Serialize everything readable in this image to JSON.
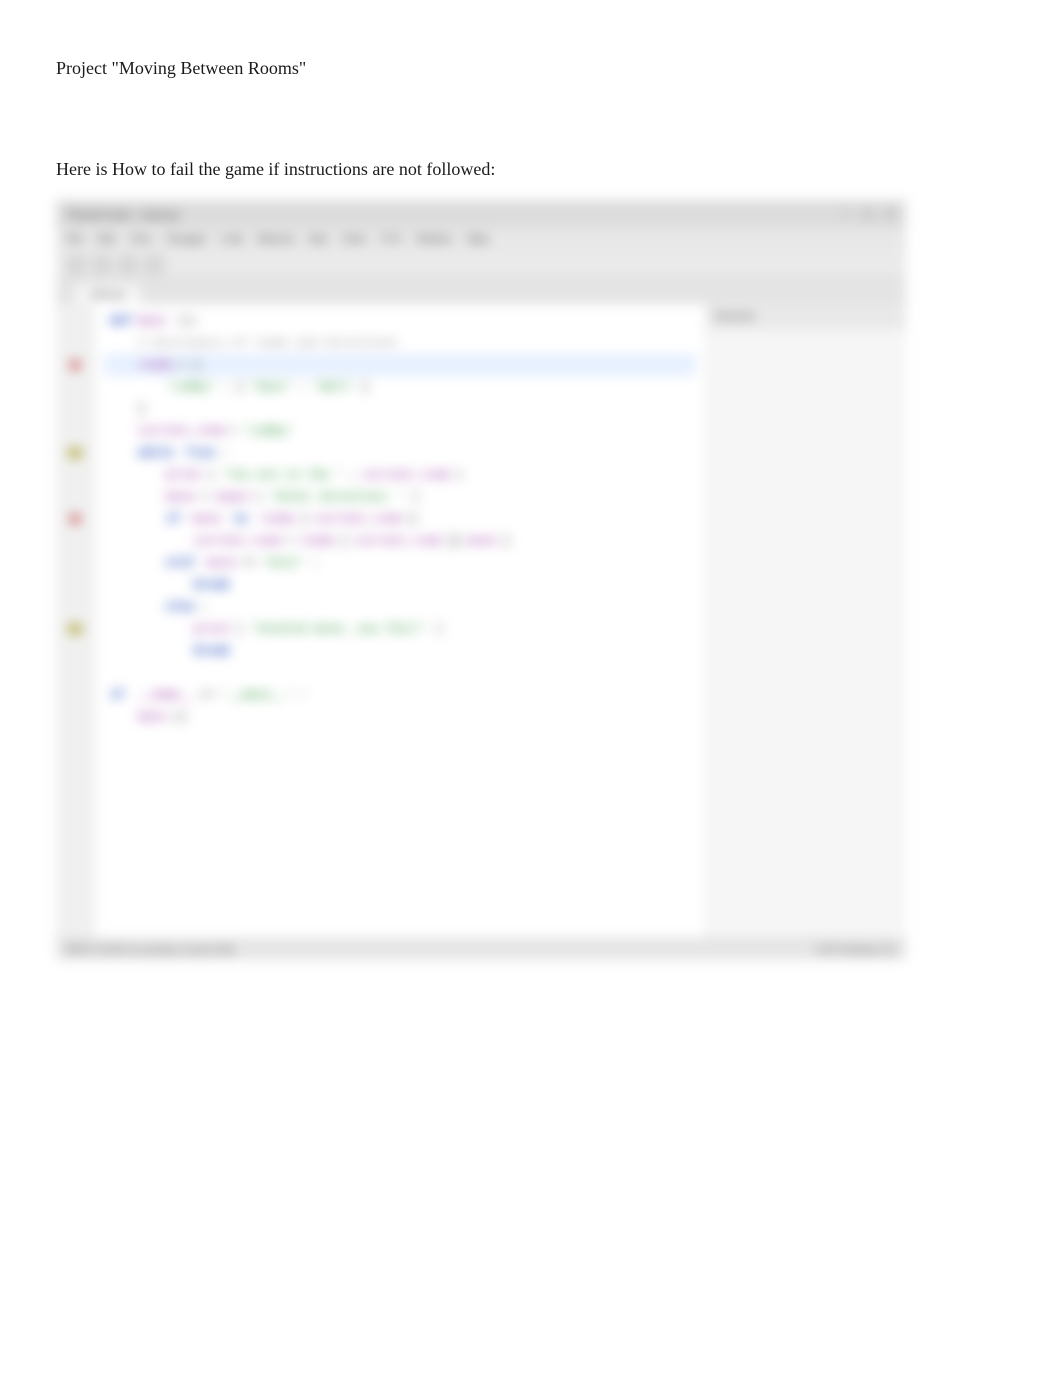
{
  "document": {
    "title": "Project \"Moving Between Rooms\"",
    "subtitle": "Here is How to fail the game if instructions are not followed:"
  },
  "ide": {
    "titlebar": "TheaterGame - main.py",
    "menu": [
      "File",
      "Edit",
      "View",
      "Navigate",
      "Code",
      "Refactor",
      "Run",
      "Tools",
      "VCS",
      "Window",
      "Help"
    ],
    "tabs": [
      "main.py"
    ],
    "right_panel_header": "Structure",
    "status_left": "PEP 8: W292 no newline at end of file",
    "status_right": "UTF-8  Python 3.9",
    "code_lines": [
      {
        "indent": 0,
        "tokens": [
          [
            "kw",
            "def"
          ],
          [
            "id",
            " main"
          ],
          [
            "",
            ""
          ],
          [
            "",
            "():"
          ]
        ]
      },
      {
        "indent": 1,
        "tokens": [
          [
            "cmt",
            "# Dictionary of rooms and directions"
          ]
        ]
      },
      {
        "indent": 1,
        "tokens": [
          [
            "id",
            "rooms"
          ],
          [
            "",
            " = {"
          ]
        ],
        "highlight": true
      },
      {
        "indent": 2,
        "tokens": [
          [
            "str",
            "'Lobby'"
          ],
          [
            "",
            ": {"
          ],
          [
            "str",
            "'East'"
          ],
          [
            "",
            ": "
          ],
          [
            "str",
            "'Hall'"
          ],
          [
            "",
            "}"
          ]
        ]
      },
      {
        "indent": 1,
        "tokens": [
          [
            "",
            "}"
          ]
        ]
      },
      {
        "indent": 1,
        "tokens": [
          [
            "id",
            "current_room"
          ],
          [
            "",
            " = "
          ],
          [
            "str",
            "'Lobby'"
          ]
        ]
      },
      {
        "indent": 1,
        "tokens": [
          [
            "kw",
            "while"
          ],
          [
            "",
            " "
          ],
          [
            "kw",
            "True"
          ],
          [
            "",
            ":"
          ]
        ]
      },
      {
        "indent": 2,
        "tokens": [
          [
            "id",
            "print"
          ],
          [
            "",
            "("
          ],
          [
            "str",
            "'You are in the '"
          ],
          [
            "",
            ", "
          ],
          [
            "id",
            "current_room"
          ],
          [
            "",
            ")"
          ]
        ]
      },
      {
        "indent": 2,
        "tokens": [
          [
            "id",
            "move"
          ],
          [
            "",
            " = "
          ],
          [
            "id",
            "input"
          ],
          [
            "",
            "("
          ],
          [
            "str",
            "'Enter direction: '"
          ],
          [
            "",
            ")"
          ]
        ]
      },
      {
        "indent": 2,
        "tokens": [
          [
            "kw",
            "if"
          ],
          [
            "",
            " "
          ],
          [
            "id",
            "move"
          ],
          [
            "",
            " "
          ],
          [
            "kw",
            "in"
          ],
          [
            "",
            " "
          ],
          [
            "id",
            "rooms"
          ],
          [
            "",
            "["
          ],
          [
            "id",
            "current_room"
          ],
          [
            "",
            "]:"
          ]
        ]
      },
      {
        "indent": 3,
        "tokens": [
          [
            "id",
            "current_room"
          ],
          [
            "",
            " = "
          ],
          [
            "id",
            "rooms"
          ],
          [
            "",
            "["
          ],
          [
            "id",
            "current_room"
          ],
          [
            "",
            "]["
          ],
          [
            "id",
            "move"
          ],
          [
            "",
            "]"
          ]
        ]
      },
      {
        "indent": 2,
        "tokens": [
          [
            "kw",
            "elif"
          ],
          [
            "",
            " "
          ],
          [
            "id",
            "move"
          ],
          [
            "",
            " == "
          ],
          [
            "str",
            "'Exit'"
          ],
          [
            "",
            ":"
          ]
        ]
      },
      {
        "indent": 3,
        "tokens": [
          [
            "kw",
            "break"
          ]
        ]
      },
      {
        "indent": 2,
        "tokens": [
          [
            "kw",
            "else"
          ],
          [
            "",
            ":"
          ]
        ]
      },
      {
        "indent": 3,
        "tokens": [
          [
            "id",
            "print"
          ],
          [
            "",
            "("
          ],
          [
            "str",
            "'Invalid move, you fail!'"
          ],
          [
            "",
            ")"
          ]
        ]
      },
      {
        "indent": 3,
        "tokens": [
          [
            "kw",
            "break"
          ]
        ]
      },
      {
        "indent": 0,
        "tokens": [
          [
            "",
            ""
          ]
        ]
      },
      {
        "indent": 0,
        "tokens": [
          [
            "kw",
            "if"
          ],
          [
            "",
            " "
          ],
          [
            "id",
            "__name__"
          ],
          [
            "",
            " == "
          ],
          [
            "str",
            "'__main__'"
          ],
          [
            "",
            ":"
          ]
        ]
      },
      {
        "indent": 1,
        "tokens": [
          [
            "id",
            "main"
          ],
          [
            "",
            "()"
          ]
        ]
      }
    ],
    "gutter_markers": [
      {
        "line": 2,
        "type": "dot"
      },
      {
        "line": 6,
        "type": "mark"
      },
      {
        "line": 9,
        "type": "dot"
      },
      {
        "line": 14,
        "type": "mark"
      }
    ]
  }
}
